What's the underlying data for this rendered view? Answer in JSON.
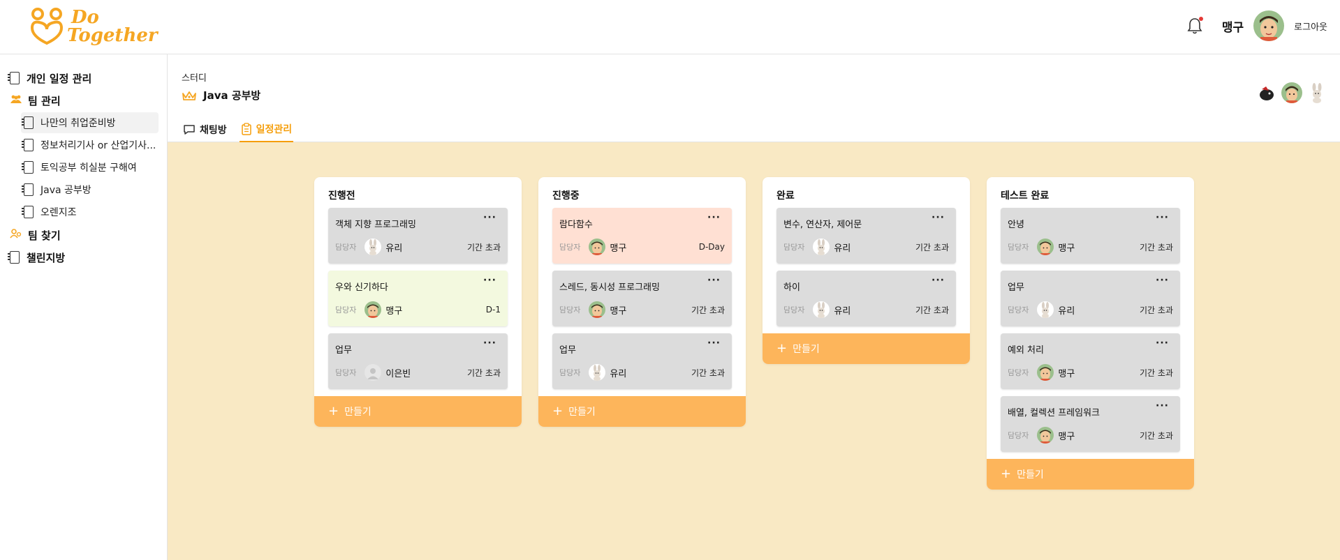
{
  "header": {
    "logo_text_line1": "Do",
    "logo_text_line2": "Together",
    "user_name": "맹구",
    "logout_label": "로그아웃"
  },
  "sidebar": {
    "personal_label": "개인 일정 관리",
    "team_label": "팀 관리",
    "teams": [
      {
        "label": "나만의 취업준비방",
        "active": true
      },
      {
        "label": "정보처리기사 or 산업기사..."
      },
      {
        "label": "토익공부 히실분 구해여"
      },
      {
        "label": "Java 공부방"
      },
      {
        "label": "오렌지조"
      }
    ],
    "find_team_label": "팀 찾기",
    "challenge_label": "챌린지방"
  },
  "study": {
    "category": "스터디",
    "title": "Java 공부방"
  },
  "tabs": [
    {
      "label": "채팅방",
      "active": false
    },
    {
      "label": "일정관리",
      "active": true
    }
  ],
  "board": {
    "assignee_label": "담당자",
    "add_label": "만들기",
    "columns": [
      {
        "title": "진행전",
        "cards": [
          {
            "title": "객체 지향 프로그래밍",
            "assignee": "유리",
            "avatar": "bunny",
            "due": "기간 초과",
            "tone": "gray"
          },
          {
            "title": "우와 신기하다",
            "assignee": "맹구",
            "avatar": "boy",
            "due": "D-1",
            "tone": "green"
          },
          {
            "title": "업무",
            "assignee": "이은빈",
            "avatar": "default",
            "due": "기간 초과",
            "tone": "gray"
          }
        ]
      },
      {
        "title": "진행중",
        "cards": [
          {
            "title": "람다함수",
            "assignee": "맹구",
            "avatar": "boy",
            "due": "D-Day",
            "tone": "pink"
          },
          {
            "title": "스레드, 동시성 프로그래밍",
            "assignee": "맹구",
            "avatar": "boy",
            "due": "기간 초과",
            "tone": "gray"
          },
          {
            "title": "업무",
            "assignee": "유리",
            "avatar": "bunny",
            "due": "기간 초과",
            "tone": "gray"
          }
        ]
      },
      {
        "title": "완료",
        "cards": [
          {
            "title": "변수, 연산자, 제어문",
            "assignee": "유리",
            "avatar": "bunny",
            "due": "기간 초과",
            "tone": "gray"
          },
          {
            "title": "하이",
            "assignee": "유리",
            "avatar": "bunny",
            "due": "기간 초과",
            "tone": "gray"
          }
        ]
      },
      {
        "title": "테스트 완료",
        "cards": [
          {
            "title": "안녕",
            "assignee": "맹구",
            "avatar": "boy",
            "due": "기간 초과",
            "tone": "gray"
          },
          {
            "title": "업무",
            "assignee": "유리",
            "avatar": "bunny",
            "due": "기간 초과",
            "tone": "gray"
          },
          {
            "title": "예외 처리",
            "assignee": "맹구",
            "avatar": "boy",
            "due": "기간 초과",
            "tone": "gray"
          },
          {
            "title": "배열, 컬렉션 프레임워크",
            "assignee": "맹구",
            "avatar": "boy",
            "due": "기간 초과",
            "tone": "gray"
          }
        ]
      }
    ]
  },
  "colors": {
    "brand": "#f5a623",
    "board_bg": "#f9e9c4",
    "add_button": "#fdb55b",
    "card_gray": "#dcdcdc",
    "card_pink": "#ffe0d3",
    "card_green": "#f3f9df",
    "notification_dot": "#e53935"
  },
  "icons": {
    "bell": "bell-icon",
    "notebook": "notebook-icon",
    "team": "team-icon",
    "crown": "crown-icon",
    "chat": "chat-bubble-icon",
    "clipboard": "clipboard-icon",
    "more": "more-dots-icon",
    "plus": "plus-icon"
  }
}
